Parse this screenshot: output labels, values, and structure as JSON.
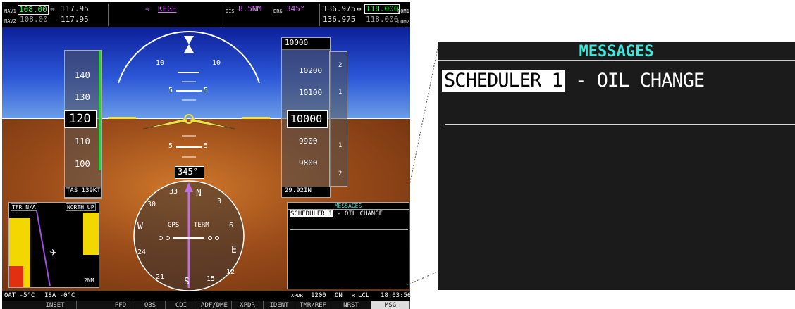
{
  "topbar": {
    "nav1_label": "NAV1",
    "nav1_active": "108.00",
    "nav1_standby": "117.95",
    "nav2_label": "NAV2",
    "nav2_active": "108.00",
    "nav2_standby": "117.95",
    "waypoint": "KEGE",
    "dis_label": "DIS",
    "dis_value": "8.5NM",
    "brg_label": "BRG",
    "brg_value": "345°",
    "com1_active": "136.975",
    "com1_standby": "118.000",
    "com1_label": "COM1",
    "com2_active": "136.975",
    "com2_standby": "118.000",
    "com2_label": "COM2"
  },
  "attitude": {
    "pitch_labels": [
      "10",
      "10",
      "5",
      "5",
      "5",
      "5"
    ]
  },
  "airspeed": {
    "ticks": [
      "140",
      "130",
      "110",
      "100"
    ],
    "current": "120",
    "tas": "TAS 139KT"
  },
  "altimeter": {
    "selected": "10000",
    "ticks": [
      "10200",
      "10100",
      "9900",
      "9800"
    ],
    "current": "10000",
    "baro": "29.92IN",
    "vs_ticks": [
      "2",
      "1",
      "1",
      "2"
    ]
  },
  "hsi": {
    "heading": "345°",
    "gps_label": "GPS",
    "term_label": "TERM",
    "compass": [
      "33",
      "N",
      "3",
      "30",
      "W",
      "E",
      "24",
      "12",
      "S",
      "21",
      "15",
      "6"
    ]
  },
  "inset": {
    "tfr": "TFR N/A",
    "orientation": "NORTH UP",
    "range": "2NM"
  },
  "status": {
    "oat": "OAT  -5°C",
    "isa": "ISA  -0°C",
    "xpdr": "XPDR",
    "squawk": "1200",
    "mode": "ON",
    "reply": "R",
    "lcl": "LCL",
    "time": "18:03:56"
  },
  "softkeys": [
    "INSET",
    "PFD",
    "OBS",
    "CDI",
    "ADF/DME",
    "XPDR",
    "IDENT",
    "TMR/REF",
    "NRST",
    "MSG"
  ],
  "messages_small": {
    "title": "MESSAGES",
    "highlight": "SCHEDULER 1",
    "text": " - OIL CHANGE"
  },
  "messages_big": {
    "title": "MESSAGES",
    "highlight": "SCHEDULER 1",
    "text": " - OIL CHANGE"
  },
  "colors": {
    "msg_title": "#3ee8dc",
    "active_freq": "#29ff4a",
    "bearing": "#e070ff"
  }
}
